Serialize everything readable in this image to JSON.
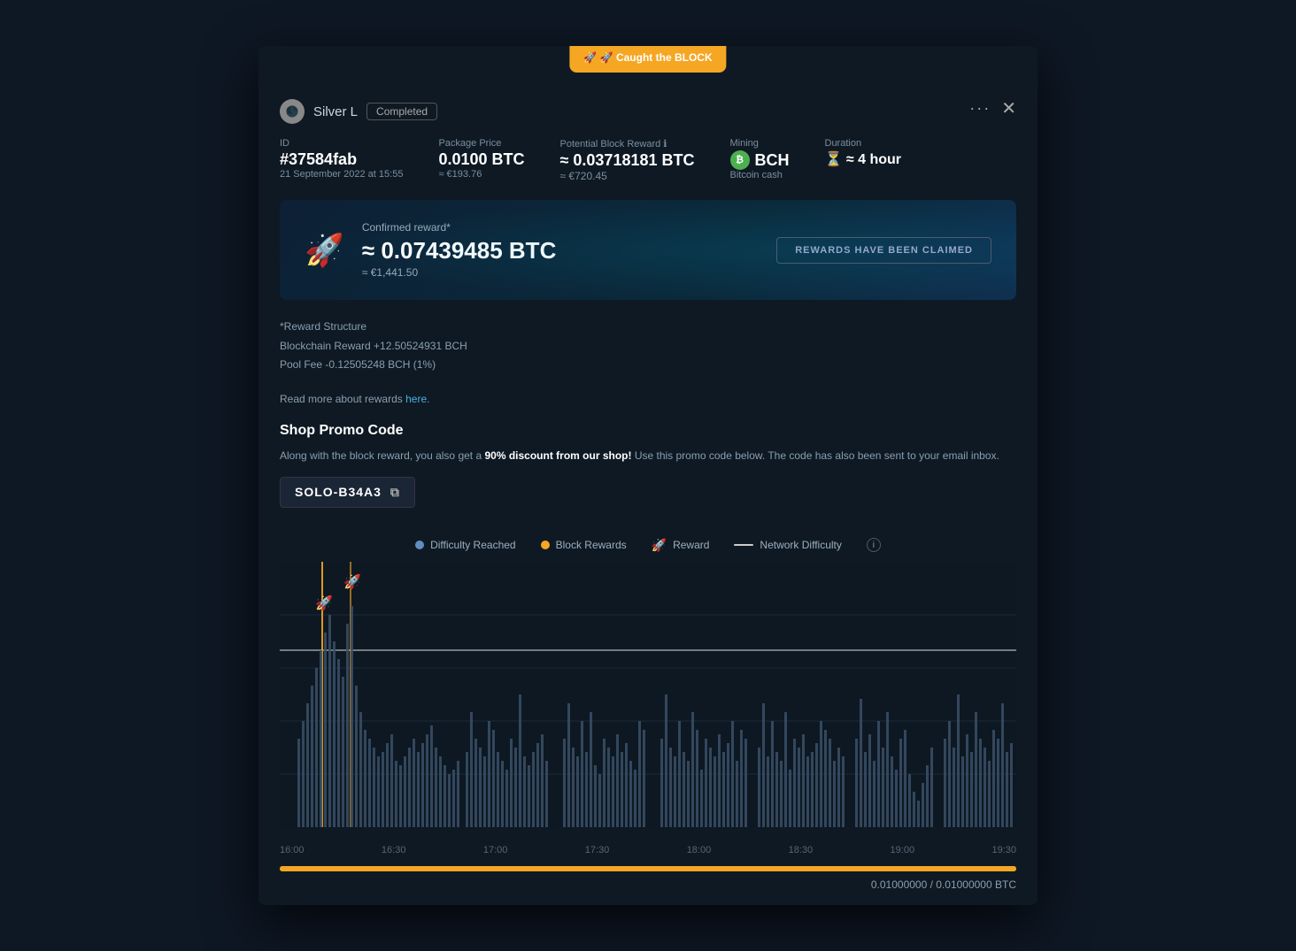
{
  "modal": {
    "caught_badge_line1": "🚀 Caught the BLOCK",
    "user": {
      "name": "Silver L",
      "status": "Completed"
    },
    "id_label": "ID",
    "id_value": "#37584fab",
    "id_date": "21 September 2022 at 15:55",
    "package_price_label": "Package Price",
    "package_price_value": "0.0100 BTC",
    "package_price_eur": "≈ €193.76",
    "potential_reward_label": "Potential Block Reward ℹ",
    "potential_reward_value": "≈ 0.03718181 BTC",
    "potential_reward_eur": "≈ €720.45",
    "mining_label": "Mining",
    "mining_coin": "BCH",
    "mining_name": "Bitcoin cash",
    "duration_label": "Duration",
    "duration_value": "≈ 4 hour",
    "confirmed_reward_label": "Confirmed reward*",
    "confirmed_reward_btc": "≈ 0.07439485 BTC",
    "confirmed_reward_eur": "≈ €1,441.50",
    "claimed_button": "REWARDS HAVE BEEN CLAIMED",
    "reward_structure_title": "*Reward Structure",
    "blockchain_reward": "Blockchain Reward +12.50524931 BCH",
    "pool_fee": "Pool Fee -0.12505248 BCH (1%)",
    "read_more_text": "Read more about rewards",
    "read_more_link": "here.",
    "promo_title": "Shop Promo Code",
    "promo_desc_part1": "Along with the block reward, you also get a ",
    "promo_desc_bold": "90% discount from our shop!",
    "promo_desc_part2": " Use this promo code below. The code has also been sent to your email inbox.",
    "promo_code": "SOLO-B34A3",
    "legend": {
      "difficulty_label": "Difficulty Reached",
      "rewards_label": "Block Rewards",
      "reward_label": "Reward",
      "network_label": "Network Difficulty"
    },
    "chart_times": [
      "16:00",
      "16:30",
      "17:00",
      "17:30",
      "18:00",
      "18:30",
      "19:00",
      "19:30"
    ],
    "progress_label": "0.01000000 / 0.01000000 BTC"
  }
}
